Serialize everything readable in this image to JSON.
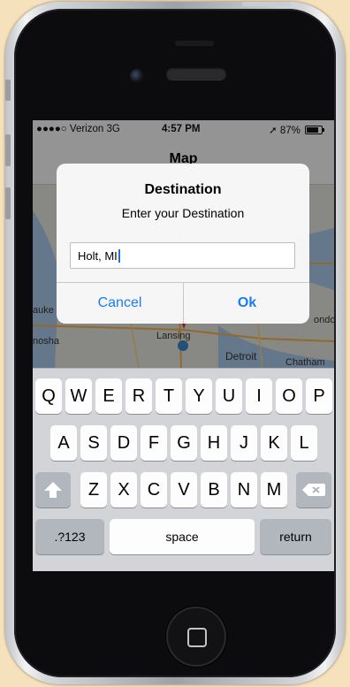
{
  "status_bar": {
    "carrier": "●●●●○ Verizon  3G",
    "time": "4:57 PM",
    "battery": "➚ 87%"
  },
  "nav": {
    "title": "Map"
  },
  "map": {
    "labels": [
      "auke",
      "nosha",
      "Lansing",
      "Detroit",
      "Chatham",
      "ondo"
    ]
  },
  "alert": {
    "title": "Destination",
    "message": "Enter your Destination",
    "input_value": "Holt, MI",
    "cancel": "Cancel",
    "ok": "Ok"
  },
  "keyboard": {
    "row1": [
      "Q",
      "W",
      "E",
      "R",
      "T",
      "Y",
      "U",
      "I",
      "O",
      "P"
    ],
    "row2": [
      "A",
      "S",
      "D",
      "F",
      "G",
      "H",
      "J",
      "K",
      "L"
    ],
    "row3": [
      "Z",
      "X",
      "C",
      "V",
      "B",
      "N",
      "M"
    ],
    "shift_icon": "shift-arrow-icon",
    "delete_icon": "backspace-icon",
    "numbers": ".?123",
    "space": "space",
    "return": "return"
  },
  "colors": {
    "accent": "#1a7cf5",
    "background": "#f5e2bd"
  }
}
